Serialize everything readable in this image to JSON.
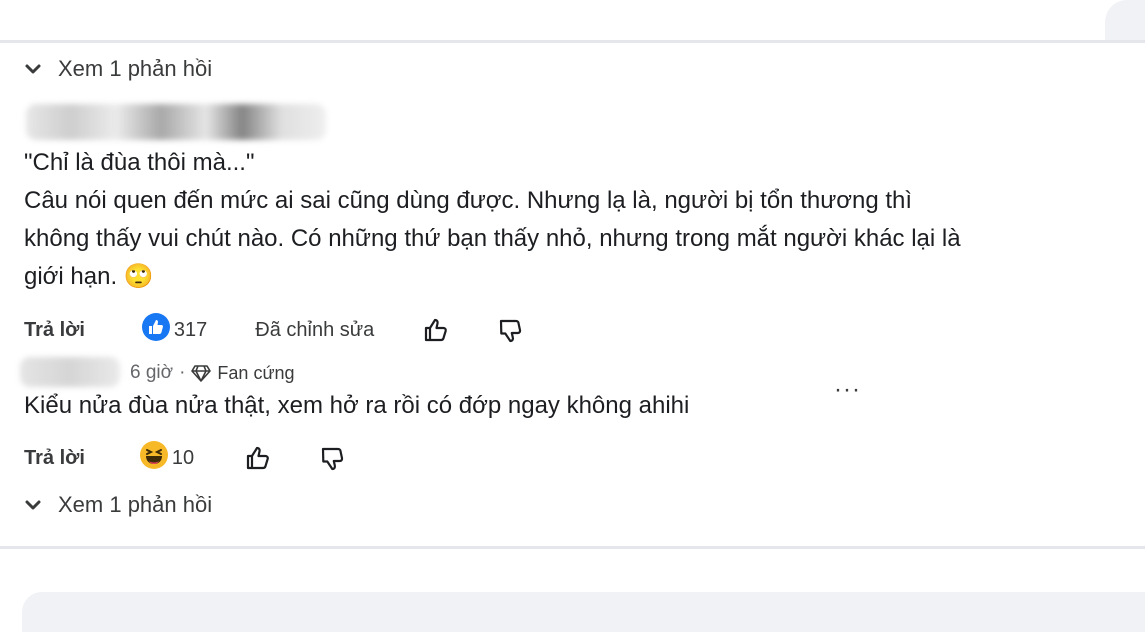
{
  "thread": {
    "view_replies_top": "Xem 1 phản hồi",
    "view_replies_bottom": "Xem 1 phản hồi"
  },
  "comment1": {
    "quote": "\"Chỉ là đùa thôi mà...\"",
    "line2": "Câu nói quen đến mức ai sai cũng dùng được. Nhưng lạ là, người bị tổn thương thì",
    "line3": "không thấy vui chút nào. Có những thứ bạn thấy nhỏ, nhưng trong mắt người khác lại là",
    "line4": "giới hạn.",
    "emoji": "🙄",
    "reply_label": "Trả lời",
    "reaction_count": "317",
    "edited_label": "Đã chỉnh sửa",
    "reaction_icon": "like-icon"
  },
  "comment2": {
    "time": "6 giờ",
    "separator": "·",
    "badge_icon": "diamond-icon",
    "badge": "Fan cứng",
    "text": "Kiểu nửa đùa nửa thật, xem hở ra rồi có đớp ngay không ahihi",
    "reply_label": "Trả lời",
    "reaction_count": "10",
    "reaction_icon": "haha-icon",
    "more": "···"
  },
  "colors": {
    "like_blue": "#1877f2",
    "haha_yellow": "#f7b928",
    "divider": "#e4e6eb"
  }
}
